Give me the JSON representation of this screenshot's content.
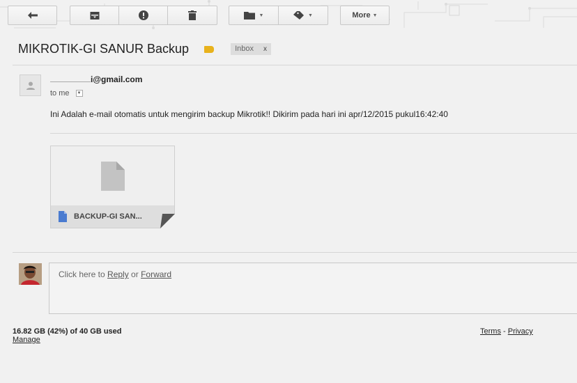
{
  "toolbar": {
    "more_label": "More"
  },
  "message": {
    "subject": "MIKROTIK-GI SANUR Backup",
    "label_chip": "Inbox",
    "label_chip_remove": "x",
    "sender_email_visible": "i@gmail.com",
    "to_label": "to me",
    "body": "Ini Adalah e-mail otomatis untuk mengirim backup Mikrotik!! Dikirim pada hari ini apr/12/2015 pukul16:42:40"
  },
  "attachment": {
    "name": "BACKUP-GI SAN..."
  },
  "reply": {
    "prefix": "Click here to ",
    "reply_link": "Reply",
    "middle": " or ",
    "forward_link": "Forward"
  },
  "footer": {
    "storage": "16.82 GB (42%) of 40 GB used",
    "manage": "Manage",
    "terms": "Terms",
    "separator": " - ",
    "privacy": "Privacy"
  },
  "colors": {
    "label_tag": "#e8b21c",
    "doc_icon": "#4a7bd0"
  },
  "icons": [
    "reply-icon",
    "archive-icon",
    "report-spam-icon",
    "delete-icon",
    "folder-icon",
    "label-icon",
    "person-icon",
    "file-icon",
    "google-doc-icon"
  ]
}
